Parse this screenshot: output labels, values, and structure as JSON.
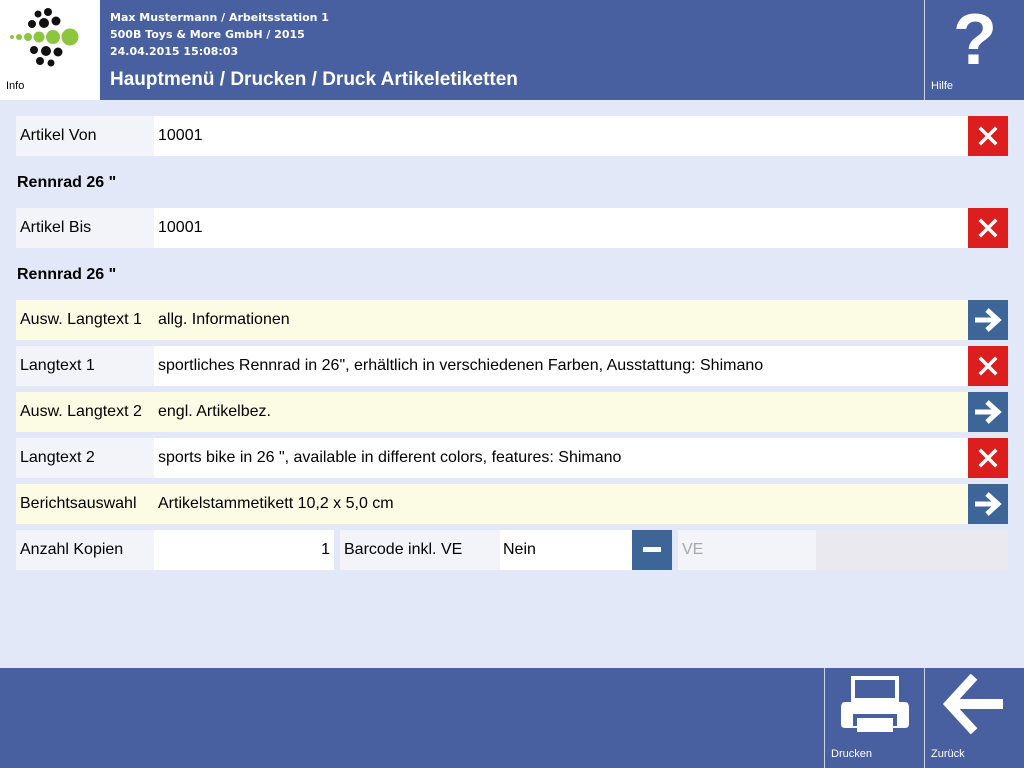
{
  "header": {
    "info_label": "Info",
    "user_line": "Max Mustermann / Arbeitsstation 1",
    "company_line": "500B Toys & More GmbH / 2015",
    "datetime_line": "24.04.2015 15:08:03",
    "breadcrumb": "Hauptmenü / Drucken / Druck Artikeletiketten",
    "help_label": "Hilfe",
    "help_glyph": "?"
  },
  "fields": {
    "artikel_von": {
      "label": "Artikel Von",
      "value": "10001",
      "description": "Rennrad 26 \""
    },
    "artikel_bis": {
      "label": "Artikel Bis",
      "value": "10001",
      "description": "Rennrad 26 \""
    },
    "ausw_langtext1": {
      "label": "Ausw. Langtext 1",
      "value": "allg. Informationen"
    },
    "langtext1": {
      "label": "Langtext 1",
      "value": "sportliches Rennrad in 26\", erhältlich in verschiedenen Farben, Ausstattung: Shimano"
    },
    "ausw_langtext2": {
      "label": "Ausw. Langtext 2",
      "value": "engl. Artikelbez."
    },
    "langtext2": {
      "label": "Langtext 2",
      "value": "sports bike in 26 \", available in different colors, features: Shimano"
    },
    "berichtsauswahl": {
      "label": "Berichtsauswahl",
      "value": "Artikelstammetikett 10,2 x 5,0 cm"
    },
    "anzahl_kopien": {
      "label": "Anzahl Kopien",
      "value": "1"
    },
    "barcode": {
      "label": "Barcode inkl. VE",
      "value": "Nein"
    },
    "ve": {
      "placeholder": "VE"
    }
  },
  "footer": {
    "print_label": "Drucken",
    "back_label": "Zurück"
  },
  "colors": {
    "header_blue": "#4860a0",
    "delete_red": "#dd1e1e",
    "nav_blue": "#3d6597",
    "logo_green": "#8cc63f"
  }
}
